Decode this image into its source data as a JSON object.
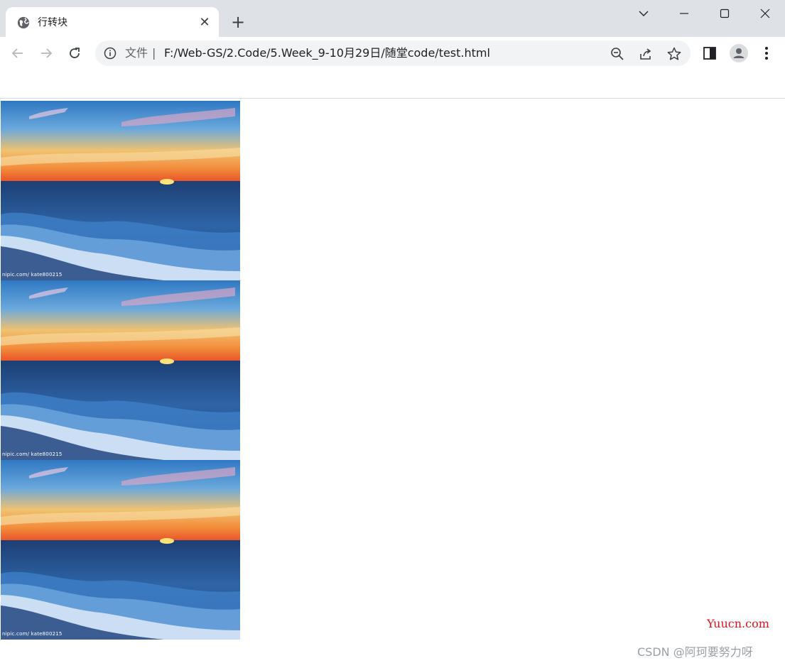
{
  "tab": {
    "title": "行转块",
    "close": "✕"
  },
  "newtab": "+",
  "window": {
    "dropdown": "⌵",
    "minimize": "—",
    "maximize": "☐",
    "close": "✕"
  },
  "omnibox": {
    "scheme_label": "文件",
    "separator": "|",
    "url": "F:/Web-GS/2.Code/5.Week_9-10月29日/随堂code/test.html"
  },
  "page": {
    "images": [
      {
        "watermark": "nipic.com/ kate800215"
      },
      {
        "watermark": "nipic.com/ kate800215"
      },
      {
        "watermark": "nipic.com/ kate800215"
      }
    ]
  },
  "overlay": {
    "yuucn": "Yuucn.com",
    "csdn": "CSDN @阿珂要努力呀"
  },
  "colors": {
    "tabstrip": "#dee1e6",
    "omnibox": "#f1f3f4",
    "yuucn": "#e0121b"
  }
}
